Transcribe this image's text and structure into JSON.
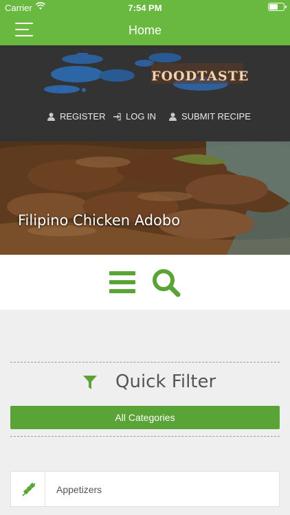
{
  "status_bar": {
    "carrier": "Carrier",
    "time": "7:54 PM"
  },
  "nav_bar": {
    "title": "Home",
    "menu_icon": "hamburger-icon"
  },
  "header": {
    "logo_text": "FOODTASTE",
    "links": [
      {
        "label": "REGISTER",
        "icon": "user-icon"
      },
      {
        "label": "LOG IN",
        "icon": "sign-in-icon"
      },
      {
        "label": "SUBMIT RECIPE",
        "icon": "user-icon"
      }
    ]
  },
  "hero": {
    "title": "Filipino Chicken Adobo"
  },
  "actions": {
    "list_icon": "list-icon",
    "search_icon": "search-icon"
  },
  "quick_filter": {
    "title": "Quick Filter",
    "icon": "filter-icon",
    "all_categories": "All Categories"
  },
  "categories": [
    {
      "label": "Appetizers",
      "icon": "kebab-icon"
    }
  ],
  "colors": {
    "brand_green": "#69b840",
    "button_green": "#5aa336",
    "header_dark": "#333333",
    "background": "#efefef"
  }
}
